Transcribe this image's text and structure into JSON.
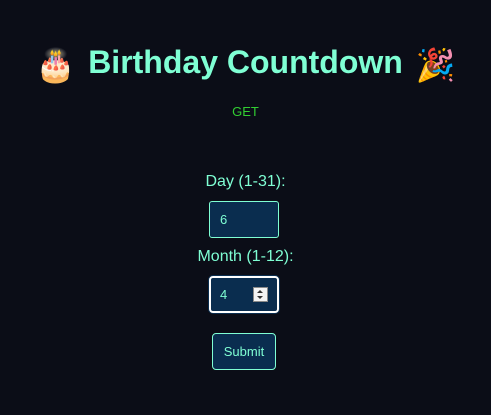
{
  "header": {
    "title": "Birthday Countdown",
    "left_emoji": "🎂",
    "right_emoji": "🎉",
    "method": "GET"
  },
  "form": {
    "day_label": "Day (1-31):",
    "day_value": "6",
    "month_label": "Month (1-12):",
    "month_value": "4",
    "submit_label": "Submit"
  },
  "colors": {
    "background": "#0b0d17",
    "accent": "#7fffd4",
    "method": "#32cd32",
    "field_bg": "#0a2d4f"
  }
}
